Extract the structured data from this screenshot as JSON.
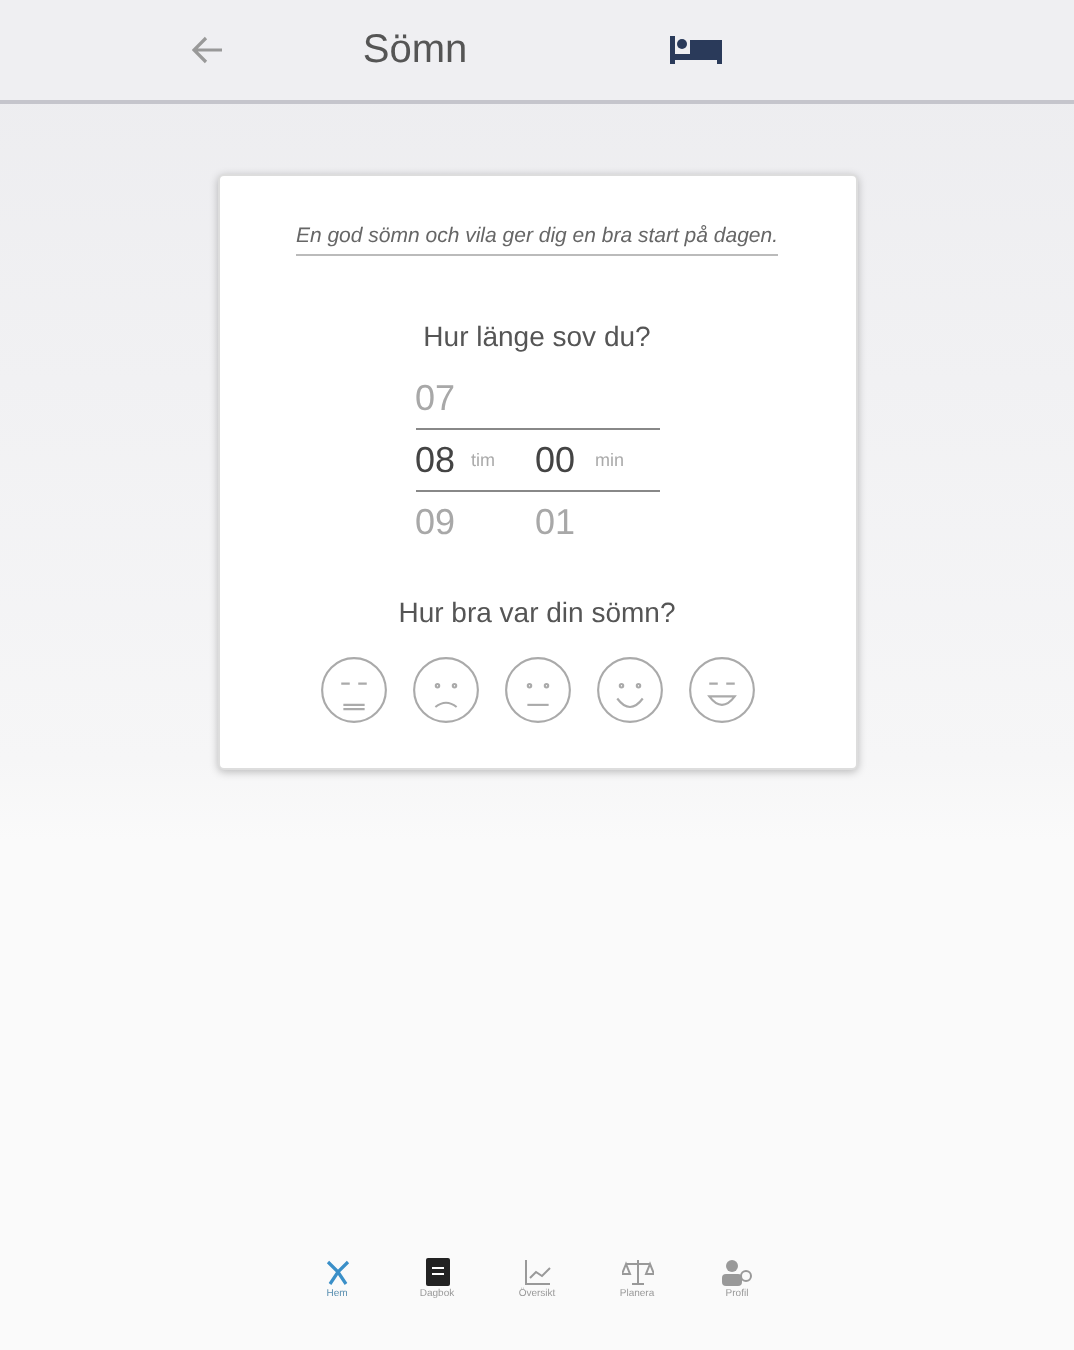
{
  "header": {
    "title": "Sömn"
  },
  "card": {
    "tagline": "En god sömn och vila ger dig en bra start på dagen.",
    "duration_question": "Hur länge sov du?",
    "picker": {
      "above": {
        "hours": "07"
      },
      "current": {
        "hours": "08",
        "hours_unit": "tim",
        "minutes": "00",
        "minutes_unit": "min"
      },
      "below": {
        "hours": "09",
        "minutes": "01"
      }
    },
    "mood_question": "Hur bra var din sömn?",
    "moods": [
      {
        "kind": "very-bad",
        "selected": false
      },
      {
        "kind": "bad",
        "selected": false
      },
      {
        "kind": "neutral",
        "selected": false
      },
      {
        "kind": "good",
        "selected": false
      },
      {
        "kind": "very-good",
        "selected": false
      }
    ]
  },
  "nav": [
    {
      "label": "Hem",
      "kind": "home",
      "selected": true
    },
    {
      "label": "Dagbok",
      "kind": "diary",
      "selected": false
    },
    {
      "label": "Översikt",
      "kind": "overview",
      "selected": false
    },
    {
      "label": "Planera",
      "kind": "plan",
      "selected": false
    },
    {
      "label": "Profil",
      "kind": "profile",
      "selected": false
    }
  ]
}
